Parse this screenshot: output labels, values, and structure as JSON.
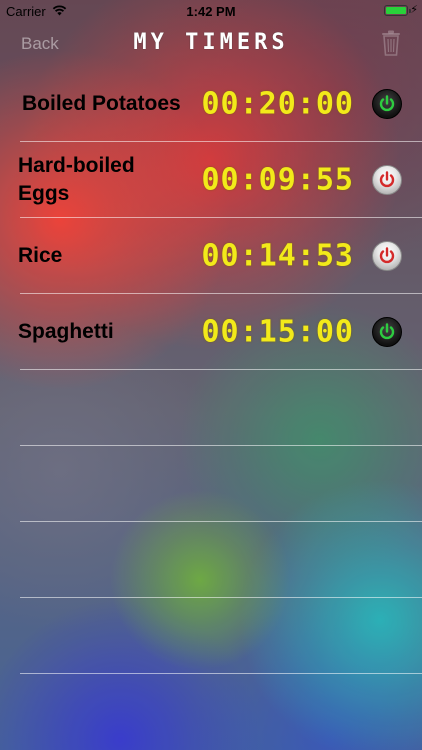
{
  "status_bar": {
    "carrier": "Carrier",
    "time": "1:42 PM",
    "battery_color": "#29d13a"
  },
  "nav": {
    "back_label": "Back",
    "title": "MY TIMERS",
    "trash_icon": "trash-icon"
  },
  "timers": [
    {
      "name": "Boiled Potatoes",
      "time": "00:20:00",
      "power_state": "on",
      "icon": "power-icon"
    },
    {
      "name": "Hard-boiled Eggs",
      "time": "00:09:55",
      "power_state": "off",
      "icon": "power-icon"
    },
    {
      "name": "Rice",
      "time": "00:14:53",
      "power_state": "off",
      "icon": "power-icon"
    },
    {
      "name": "Spaghetti",
      "time": "00:15:00",
      "power_state": "on",
      "icon": "power-icon"
    }
  ],
  "colors": {
    "timer_digits": "#f2ea1a",
    "power_on": "#2ecc40",
    "power_off": "#d42a2a"
  }
}
